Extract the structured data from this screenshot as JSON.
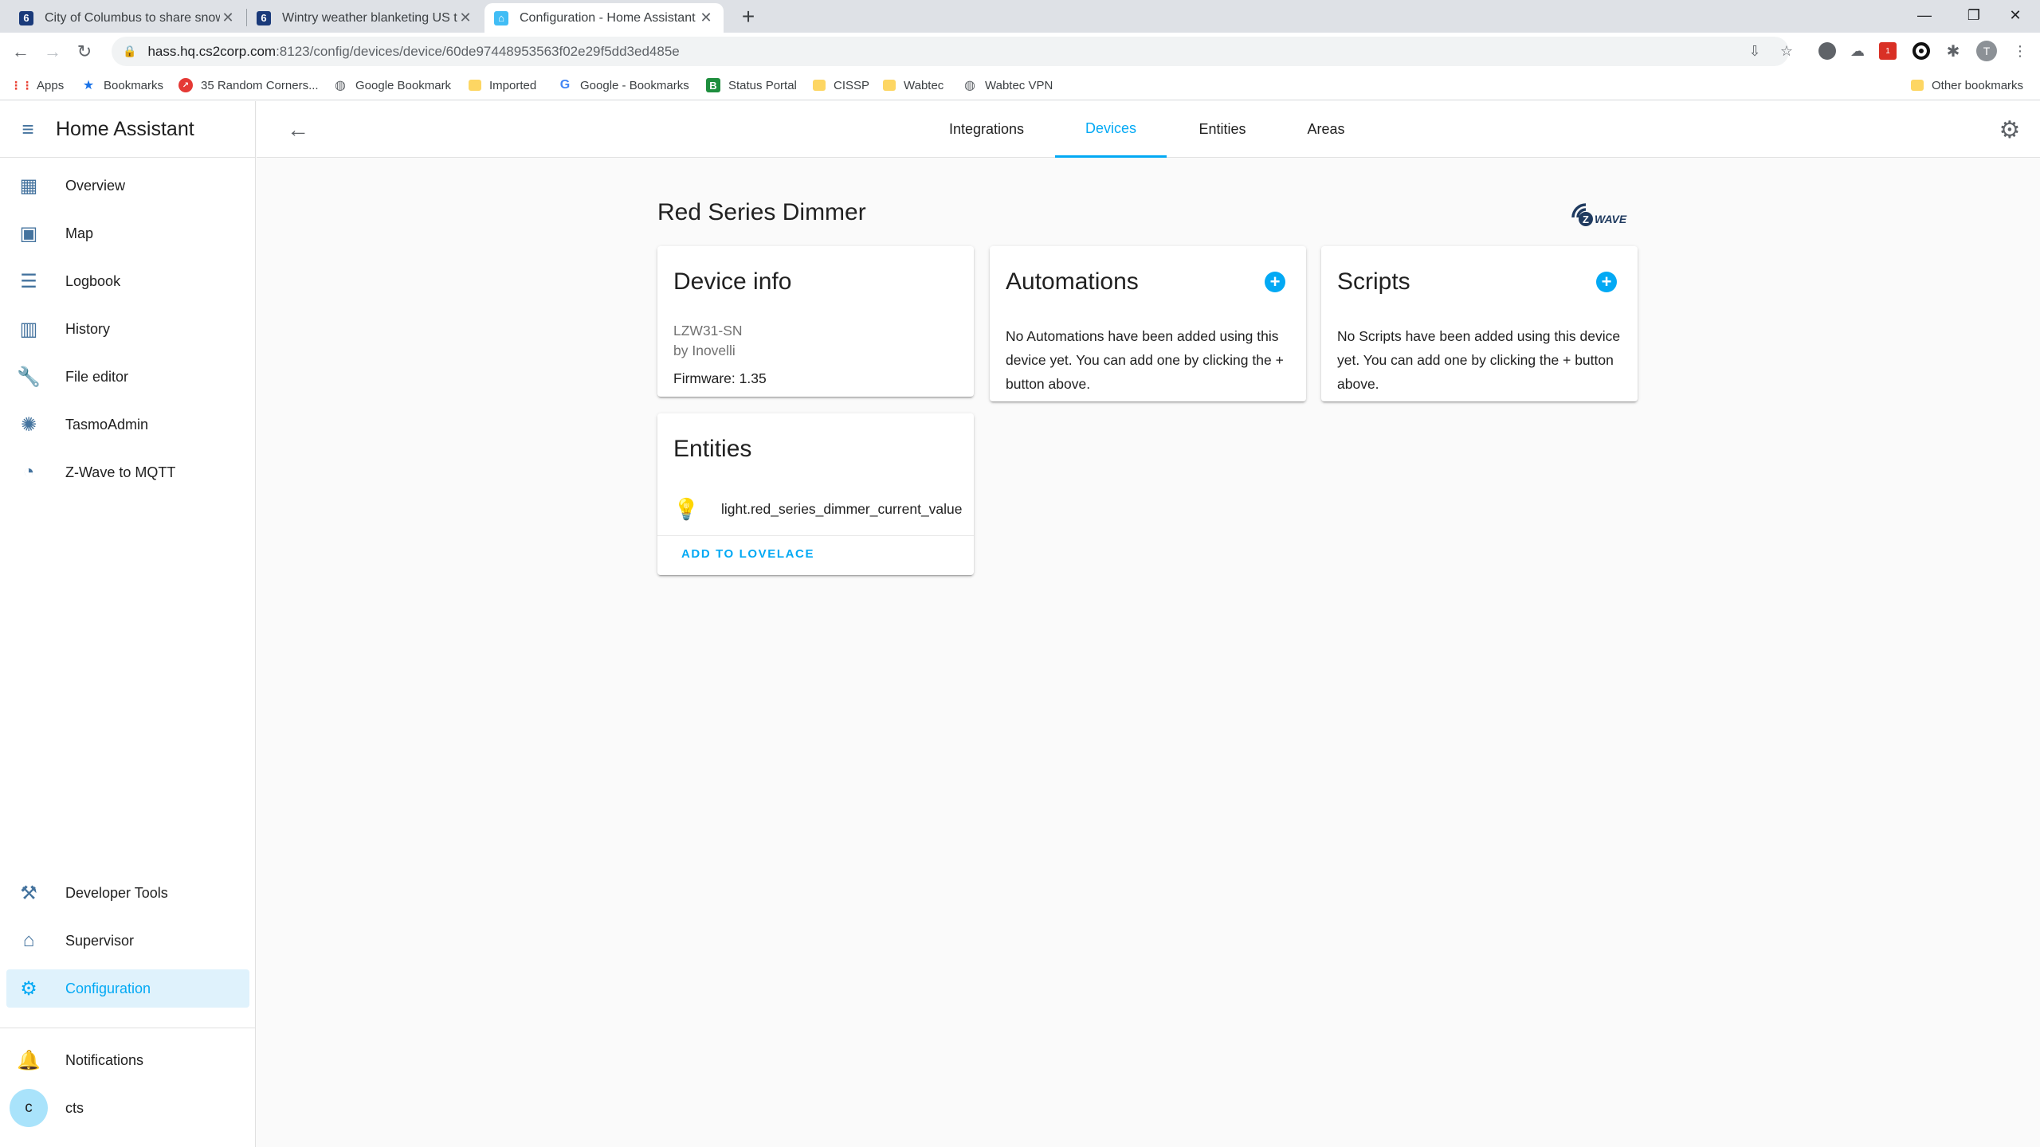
{
  "browser": {
    "tabs": [
      {
        "title": "City of Columbus to share snow c",
        "favicon": "6"
      },
      {
        "title": "Wintry weather blanketing US to",
        "favicon": "6"
      },
      {
        "title": "Configuration - Home Assistant",
        "favicon": "ha"
      }
    ],
    "url_host": "hass.hq.cs2corp.com",
    "url_path": ":8123/config/devices/device/60de97448953563f02e29f5dd3ed485e",
    "profile_initial": "T",
    "bookmarks": [
      {
        "label": "Apps"
      },
      {
        "label": "Bookmarks"
      },
      {
        "label": "35 Random Corners..."
      },
      {
        "label": "Google Bookmark"
      },
      {
        "label": "Imported"
      },
      {
        "label": "Google - Bookmarks"
      },
      {
        "label": "Status Portal",
        "icon_letter": "B"
      },
      {
        "label": "CISSP"
      },
      {
        "label": "Wabtec"
      },
      {
        "label": "Wabtec VPN"
      }
    ],
    "other_bookmarks": "Other bookmarks",
    "ext_badge": "1"
  },
  "sidebar": {
    "title": "Home Assistant",
    "items": [
      {
        "label": "Overview",
        "icon": "dashboard-icon"
      },
      {
        "label": "Map",
        "icon": "map-icon"
      },
      {
        "label": "Logbook",
        "icon": "list-icon"
      },
      {
        "label": "History",
        "icon": "chart-icon"
      },
      {
        "label": "File editor",
        "icon": "wrench-icon"
      },
      {
        "label": "TasmoAdmin",
        "icon": "lightbulb-icon"
      },
      {
        "label": "Z-Wave to MQTT",
        "icon": "zwave-icon"
      }
    ],
    "bottom_items": [
      {
        "label": "Developer Tools",
        "icon": "hammer-icon"
      },
      {
        "label": "Supervisor",
        "icon": "home-assistant-icon"
      },
      {
        "label": "Configuration",
        "icon": "gear-icon"
      }
    ],
    "notifications": "Notifications",
    "user_initial": "c",
    "user_name": "cts"
  },
  "tabs": [
    "Integrations",
    "Devices",
    "Entities",
    "Areas"
  ],
  "active_tab": "Devices",
  "device": {
    "name": "Red Series Dimmer",
    "logo_text": "WAVE",
    "logo_letter": "Z"
  },
  "device_info": {
    "title": "Device info",
    "model": "LZW31-SN",
    "manufacturer": "by Inovelli",
    "firmware": "Firmware: 1.35"
  },
  "automations": {
    "title": "Automations",
    "text": "No Automations have been added using this device yet. You can add one by clicking the + button above."
  },
  "scripts": {
    "title": "Scripts",
    "text": "No Scripts have been added using this device yet. You can add one by clicking the + button above."
  },
  "entities": {
    "title": "Entities",
    "items": [
      "light.red_series_dimmer_current_value"
    ],
    "action": "ADD TO LOVELACE"
  },
  "colors": {
    "accent": "#03a9f4",
    "icon": "#44739e",
    "selected_bg": "#dff2fc"
  }
}
